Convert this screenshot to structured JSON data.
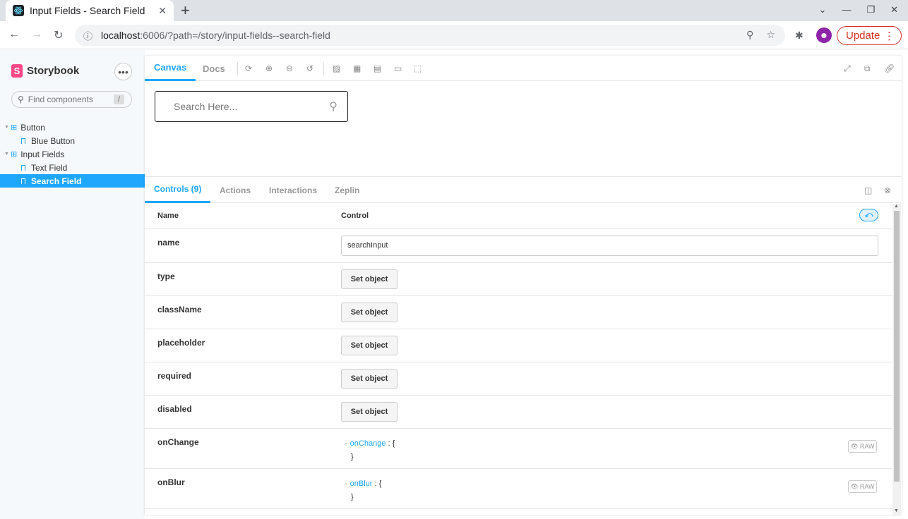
{
  "browser": {
    "tab_title": "Input Fields - Search Field",
    "url_host": "localhost",
    "url_rest": ":6006/?path=/story/input-fields--search-field",
    "update_label": "Update"
  },
  "sidebar": {
    "brand": "Storybook",
    "search_placeholder": "Find components",
    "search_shortcut": "/",
    "tree": [
      {
        "label": "Button",
        "kind": "group"
      },
      {
        "label": "Blue Button",
        "kind": "story"
      },
      {
        "label": "Input Fields",
        "kind": "group"
      },
      {
        "label": "Text Field",
        "kind": "story"
      },
      {
        "label": "Search Field",
        "kind": "story",
        "active": true
      }
    ]
  },
  "toolbar": {
    "tab_canvas": "Canvas",
    "tab_docs": "Docs"
  },
  "canvas": {
    "search_placeholder": "Search Here..."
  },
  "addons": {
    "tab_controls": "Controls (9)",
    "tab_actions": "Actions",
    "tab_interactions": "Interactions",
    "tab_zeplin": "Zeplin",
    "col_name": "Name",
    "col_control": "Control",
    "rows": {
      "name": {
        "label": "name",
        "value": "searchInput"
      },
      "type": {
        "label": "type",
        "button": "Set object"
      },
      "className": {
        "label": "className",
        "button": "Set object"
      },
      "placeholder": {
        "label": "placeholder",
        "button": "Set object"
      },
      "required": {
        "label": "required",
        "button": "Set object"
      },
      "disabled": {
        "label": "disabled",
        "button": "Set object"
      },
      "onChange": {
        "label": "onChange",
        "key": "onChange",
        "open": " : {",
        "close": "}",
        "raw": "RAW"
      },
      "onBlur": {
        "label": "onBlur",
        "key": "onBlur",
        "open": " : {",
        "close": "}",
        "raw": "RAW"
      }
    }
  },
  "colors": {
    "accent": "#1ea7fd",
    "brand": "#ff4785",
    "update": "#d93025"
  }
}
